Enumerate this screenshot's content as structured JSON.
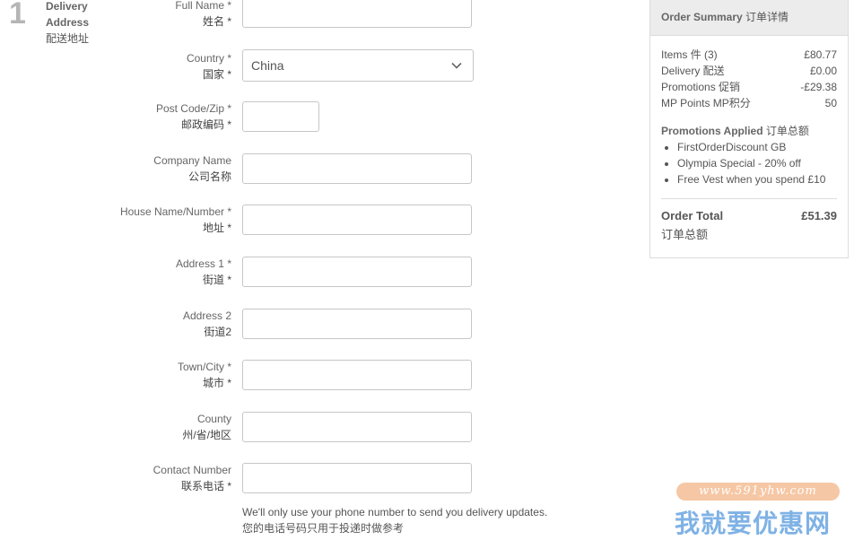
{
  "step": {
    "number": "1",
    "title_en": "Delivery Address",
    "title_zh": "配送地址"
  },
  "fields": [
    {
      "en": "Full Name *",
      "zh": "姓名 *",
      "value": ""
    },
    {
      "en": "Country *",
      "zh": "国家 *",
      "value": "China"
    },
    {
      "en": "Post Code/Zip *",
      "zh": "邮政编码 *",
      "value": ""
    },
    {
      "en": "Company Name",
      "zh": "公司名称",
      "value": ""
    },
    {
      "en": "House Name/Number *",
      "zh": "地址 *",
      "value": ""
    },
    {
      "en": "Address 1 *",
      "zh": "街道 *",
      "value": ""
    },
    {
      "en": "Address 2",
      "zh": "街道2",
      "value": ""
    },
    {
      "en": "Town/City *",
      "zh": "城市 *",
      "value": ""
    },
    {
      "en": "County",
      "zh": "州/省/地区",
      "value": ""
    },
    {
      "en": "Contact Number",
      "zh": "联系电话 *",
      "value": ""
    }
  ],
  "phone_help": {
    "en": "We'll only use your phone number to send you delivery updates.",
    "zh": "您的电话号码只用于投递时做参考"
  },
  "summary": {
    "title_en": "Order Summary",
    "title_zh": "订单详情",
    "lines": [
      {
        "label": "Items 件 (3)",
        "value": "£80.77"
      },
      {
        "label": "Delivery 配送",
        "value": "£0.00"
      },
      {
        "label": "Promotions 促销",
        "value": "-£29.38"
      },
      {
        "label": "MP Points MP积分",
        "value": "50"
      }
    ],
    "promotions_title_en": "Promotions Applied",
    "promotions_title_zh": "订单总额",
    "promotions": [
      "FirstOrderDiscount GB",
      "Olympia Special - 20% off",
      "Free Vest when you spend £10"
    ],
    "total_label_en": "Order Total",
    "total_label_zh": "订单总额",
    "total_value": "£51.39"
  },
  "watermark": {
    "url": "www.591yhw.com",
    "text": "我就要优惠网"
  },
  "colors": {
    "border": "#c6c6c6",
    "header_bg": "#ececec",
    "step_number": "#b5b5b5",
    "watermark_blue": "#7fb2e5",
    "watermark_pill": "#f6c7a4"
  }
}
